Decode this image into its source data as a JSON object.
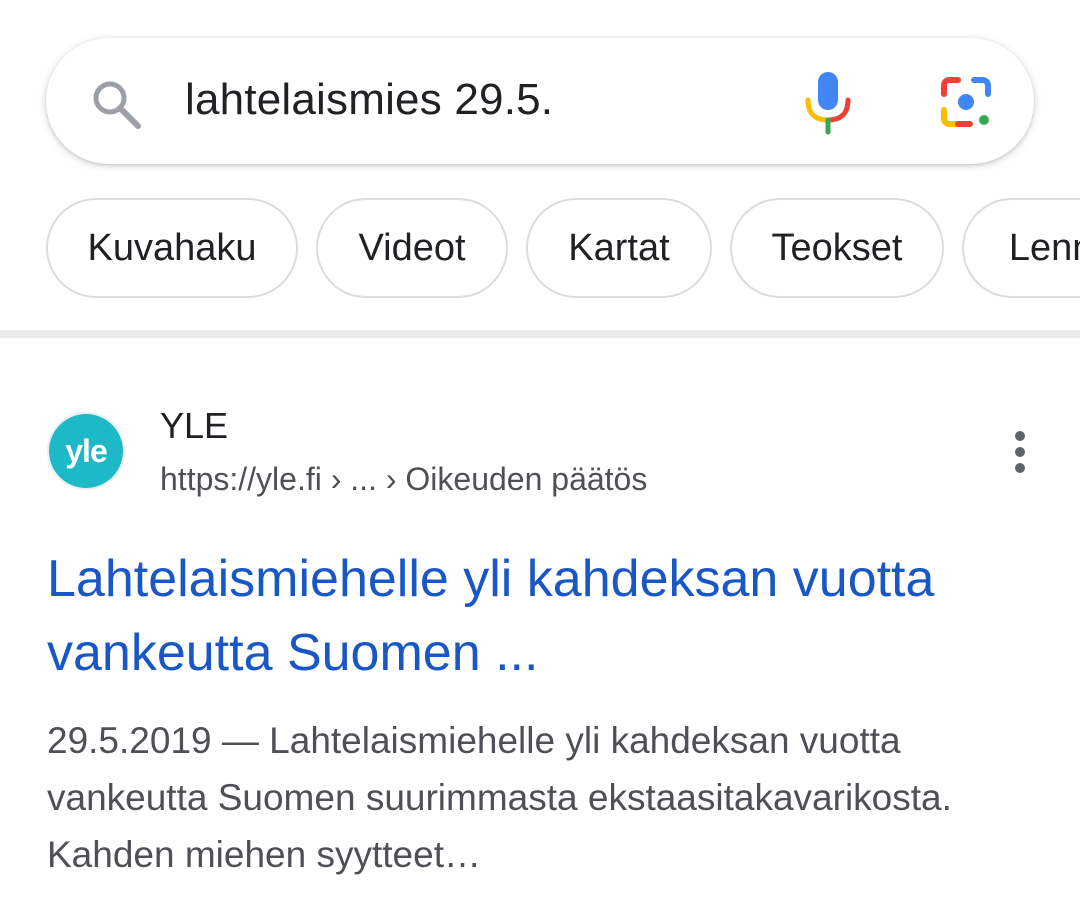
{
  "search": {
    "query": "lahtelaismies 29.5."
  },
  "chips": [
    {
      "label": "Kuvahaku"
    },
    {
      "label": "Videot"
    },
    {
      "label": "Kartat"
    },
    {
      "label": "Teokset"
    },
    {
      "label": "Lennot"
    }
  ],
  "result": {
    "favicon_text": "yle",
    "site_name": "YLE",
    "url": "https://yle.fi › ... › Oikeuden päätös",
    "title": "Lahtelaismiehelle yli kahdeksan vuotta vankeutta Suomen ...",
    "snippet": "29.5.2019 — Lahtelaismiehelle yli kahdeksan vuotta vankeutta Suomen suurimmasta ekstaasitakavarikosta. Kahden miehen syytteet…"
  },
  "icons": {
    "search": "search-icon",
    "mic": "mic-icon",
    "lens": "lens-icon",
    "more": "more-vert-icon"
  },
  "colors": {
    "link": "#1a57c6",
    "yle_brand": "#1db9c7",
    "google_blue": "#4285f4",
    "google_red": "#ea4335",
    "google_yellow": "#fbbc04",
    "google_green": "#34a853"
  }
}
